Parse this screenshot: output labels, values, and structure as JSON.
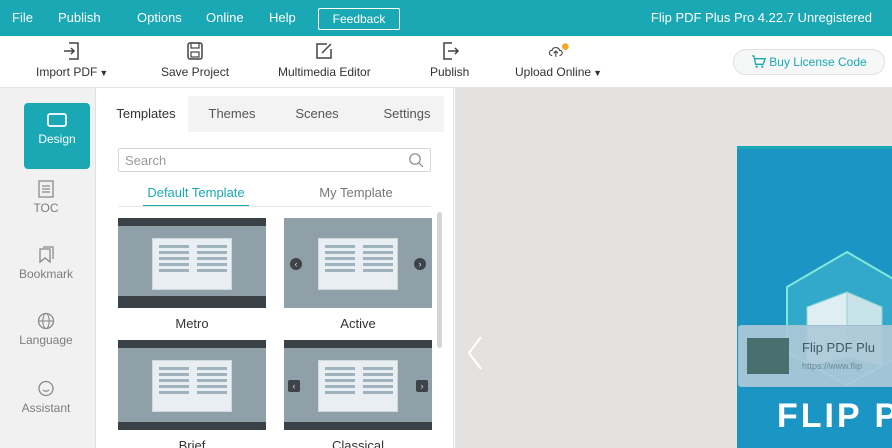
{
  "menu": {
    "items": [
      "File",
      "Publish",
      "Options",
      "Online",
      "Help"
    ],
    "feedback": "Feedback",
    "app_title": "Flip PDF Plus Pro 4.22.7 Unregistered"
  },
  "toolbar": {
    "import_pdf": "Import PDF",
    "save_project": "Save Project",
    "multimedia_editor": "Multimedia Editor",
    "publish": "Publish",
    "upload_online": "Upload Online",
    "buy_license": "Buy License Code",
    "icons": {
      "import": "import-icon",
      "save": "save-icon",
      "edit": "edit-icon",
      "publish": "export-icon",
      "upload": "cloud-upload-icon",
      "cart": "cart-icon"
    }
  },
  "rail": {
    "items": [
      {
        "label": "Design",
        "icon": "design-icon",
        "active": true
      },
      {
        "label": "TOC",
        "icon": "toc-icon",
        "active": false
      },
      {
        "label": "Bookmark",
        "icon": "bookmark-icon",
        "active": false
      },
      {
        "label": "Language",
        "icon": "globe-icon",
        "active": false
      },
      {
        "label": "Assistant",
        "icon": "chat-icon",
        "active": false
      }
    ]
  },
  "panel": {
    "tabs": [
      "Templates",
      "Themes",
      "Scenes",
      "Settings"
    ],
    "active_tab": "Templates",
    "search_placeholder": "Search",
    "subtabs": [
      "Default Template",
      "My Template"
    ],
    "templates": [
      "Metro",
      "Active",
      "Brief",
      "Classical"
    ]
  },
  "preview": {
    "card_title": "Flip PDF Plu",
    "card_url": "https://www.flip",
    "cover_title": "FLIP P"
  },
  "colors": {
    "accent": "#1aa8b5",
    "cover_blue": "#1b95c4",
    "rail_bg": "#f1f1f1",
    "preview_bg": "#e3e2e0"
  }
}
